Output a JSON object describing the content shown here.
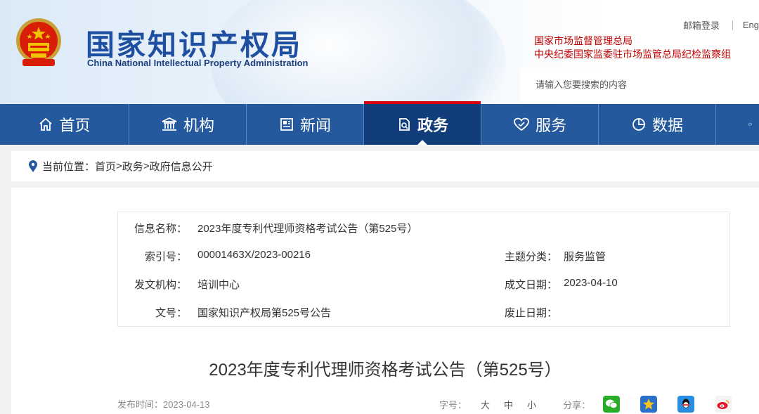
{
  "header": {
    "logo_cn": "国家知识产权局",
    "logo_en": "China National Intellectual Property Administration",
    "top_links": [
      "邮箱登录",
      "Eng"
    ],
    "related_links": [
      "国家市场监督管理总局",
      "中央纪委国家监委驻市场监管总局纪检监察组"
    ],
    "search_placeholder": "请输入您要搜索的内容"
  },
  "nav": {
    "items": [
      {
        "label": "首页",
        "icon": "home-icon"
      },
      {
        "label": "机构",
        "icon": "institution-icon"
      },
      {
        "label": "新闻",
        "icon": "news-icon"
      },
      {
        "label": "政务",
        "icon": "government-affairs-icon",
        "active": true
      },
      {
        "label": "服务",
        "icon": "service-icon"
      },
      {
        "label": "数据",
        "icon": "data-pie-icon"
      }
    ]
  },
  "breadcrumb": {
    "prefix": "当前位置：",
    "items": [
      "首页",
      "政务",
      "政府信息公开"
    ],
    "separator": ">"
  },
  "info": {
    "name_label": "信息名称：",
    "name_value": "2023年度专利代理师资格考试公告（第525号）",
    "index_label": "索引号：",
    "index_value": "00001463X/2023-00216",
    "topic_label": "主题分类：",
    "topic_value": "服务监管",
    "issuer_label": "发文机构：",
    "issuer_value": "培训中心",
    "date_label": "成文日期：",
    "date_value": "2023-04-10",
    "docno_label": "文号：",
    "docno_value": "国家知识产权局第525号公告",
    "expiry_label": "废止日期：",
    "expiry_value": ""
  },
  "article": {
    "title": "2023年度专利代理师资格考试公告（第525号）",
    "publish_label": "发布时间：",
    "publish_date": "2023-04-13",
    "font_size_label": "字号：",
    "font_sizes": [
      "大",
      "中",
      "小"
    ],
    "share_label": "分享："
  },
  "colors": {
    "nav_bg": "#24599e",
    "nav_active": "#113e7b",
    "brand_blue": "#1f4fa0",
    "accent_red": "#d7000f"
  }
}
